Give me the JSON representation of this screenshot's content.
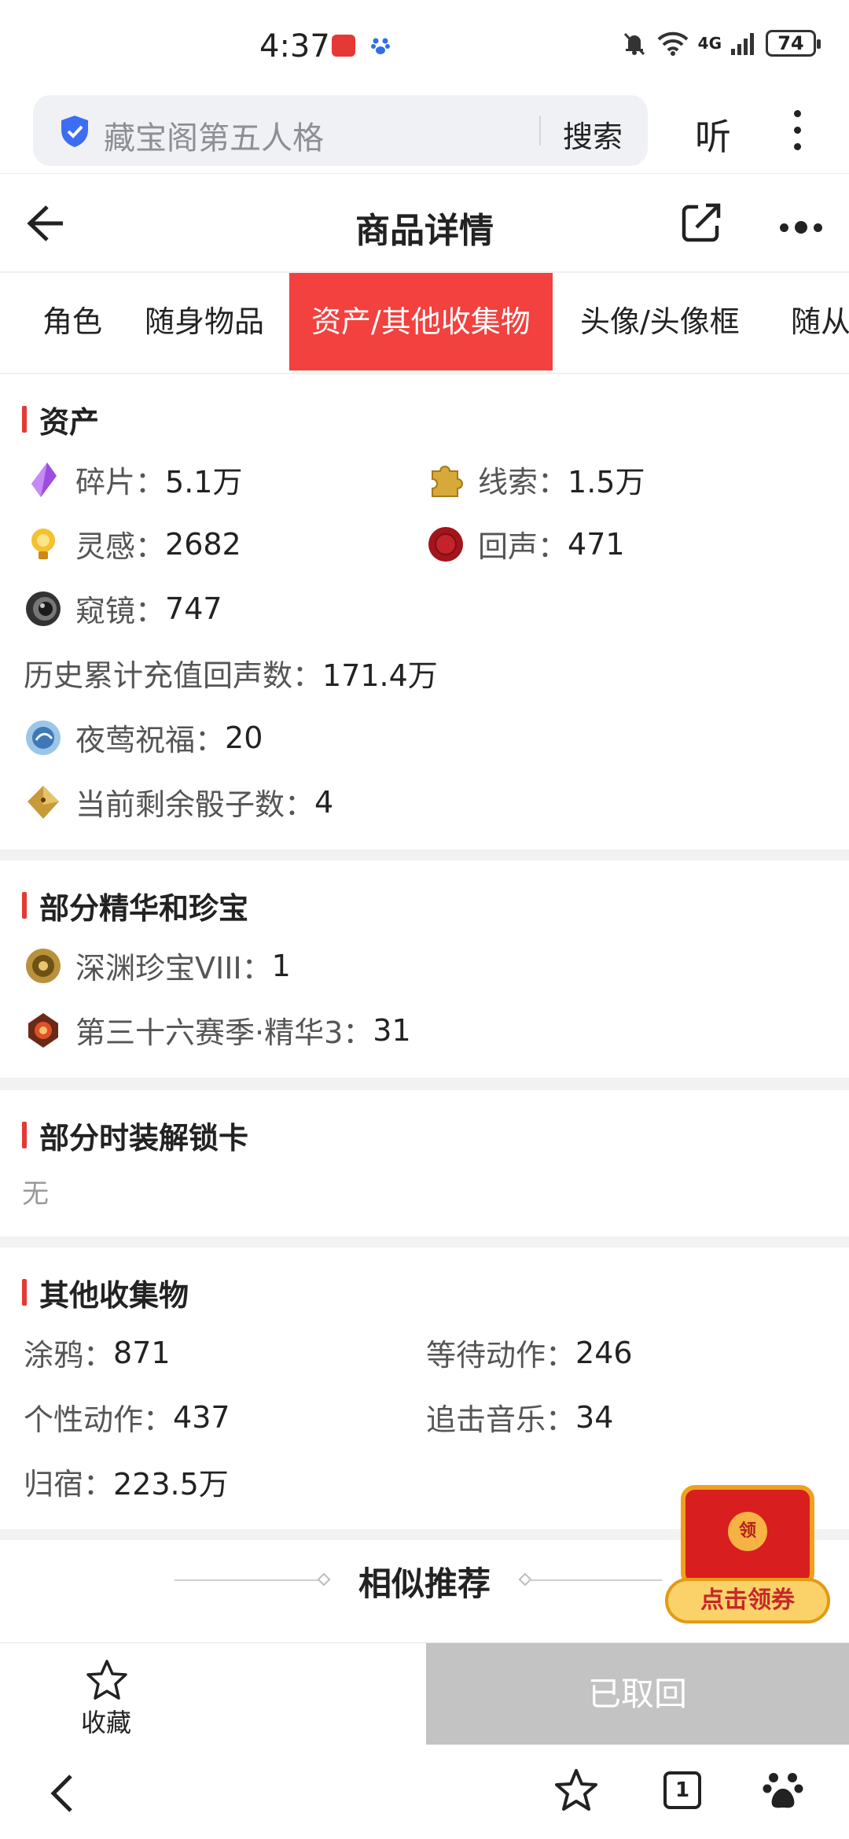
{
  "status_bar": {
    "time": "4:37",
    "battery": "74",
    "network": "4G"
  },
  "search": {
    "query": "藏宝阁第五人格",
    "button": "搜索",
    "listen": "听"
  },
  "navbar": {
    "title": "商品详情"
  },
  "tabs": [
    "角色",
    "随身物品",
    "资产/其他收集物",
    "头像/头像框",
    "随从"
  ],
  "assets": {
    "title": "资产",
    "items": [
      {
        "label": "碎片：",
        "value": "5.1万",
        "icon": "crystal-shard-icon"
      },
      {
        "label": "线索：",
        "value": "1.5万",
        "icon": "puzzle-piece-icon"
      },
      {
        "label": "灵感：",
        "value": "2682",
        "icon": "lightbulb-icon"
      },
      {
        "label": "回声：",
        "value": "471",
        "icon": "wax-seal-icon"
      },
      {
        "label": "窥镜：",
        "value": "747",
        "icon": "lens-icon"
      },
      {
        "label": "历史累计充值回声数：",
        "value": "171.4万"
      },
      {
        "label": "夜莺祝福：",
        "value": "20",
        "icon": "nightingale-orb-icon"
      },
      {
        "label": "当前剩余骰子数：",
        "value": "4",
        "icon": "dice-icon"
      }
    ]
  },
  "essence": {
    "title": "部分精华和珍宝",
    "items": [
      {
        "label": "深渊珍宝VIII：",
        "value": "1",
        "icon": "abyss-treasure-icon"
      },
      {
        "label": "第三十六赛季·精华3：",
        "value": "31",
        "icon": "essence-icon"
      }
    ]
  },
  "costume_cards": {
    "title": "部分时装解锁卡",
    "empty_text": "无"
  },
  "collectibles": {
    "title": "其他收集物",
    "items": [
      {
        "label": "涂鸦：",
        "value": "871"
      },
      {
        "label": "等待动作：",
        "value": "246"
      },
      {
        "label": "个性动作：",
        "value": "437"
      },
      {
        "label": "追击音乐：",
        "value": "34"
      },
      {
        "label": "归宿：",
        "value": "223.5万"
      }
    ]
  },
  "similar": {
    "title": "相似推荐"
  },
  "red_packet": {
    "seal": "领",
    "cta": "点击领券"
  },
  "action_bar": {
    "favorite": "收藏",
    "status_button": "已取回"
  },
  "system_nav": {
    "tab_count": "1"
  },
  "colors": {
    "accent": "#f2413e",
    "disabled": "#c3c3c3"
  }
}
